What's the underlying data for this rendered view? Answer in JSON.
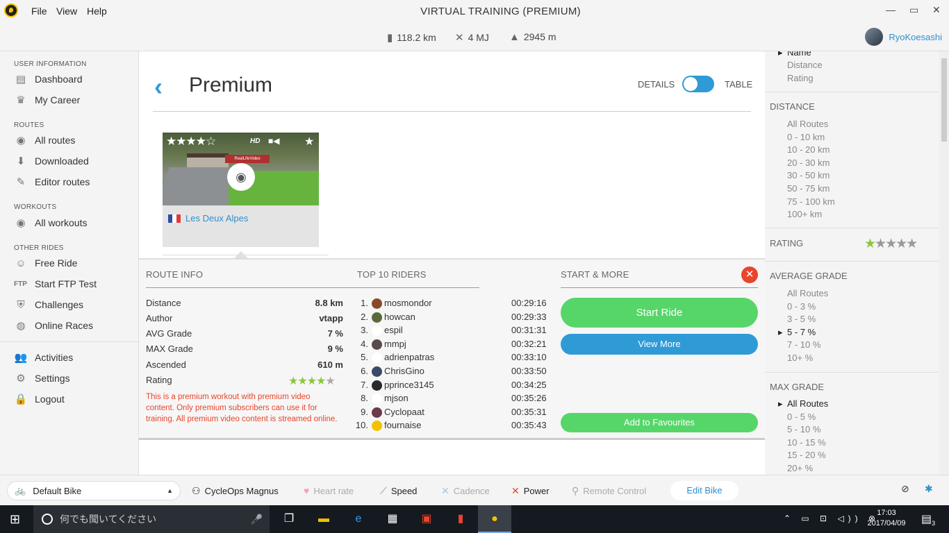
{
  "window": {
    "title": "VIRTUAL TRAINING (PREMIUM)",
    "minimize": "—",
    "restore": "▭",
    "close": "✕"
  },
  "menu": {
    "file": "File",
    "view": "View",
    "help": "Help"
  },
  "stats": {
    "distance": "118.2 km",
    "energy": "4 MJ",
    "climb": "2945 m"
  },
  "user": {
    "name": "RyoKoesashi"
  },
  "sidebar": {
    "user_info": "USER INFORMATION",
    "dashboard": "Dashboard",
    "career": "My Career",
    "routes": "ROUTES",
    "all_routes": "All routes",
    "downloaded": "Downloaded",
    "editor_routes": "Editor routes",
    "workouts": "WORKOUTS",
    "all_workouts": "All workouts",
    "other_rides": "OTHER RIDES",
    "free_ride": "Free Ride",
    "ftp_prefix": "FTP",
    "ftp_test": "Start FTP Test",
    "challenges": "Challenges",
    "online_races": "Online Races",
    "activities": "Activities",
    "settings": "Settings",
    "logout": "Logout"
  },
  "page": {
    "back": "‹",
    "title": "Premium",
    "details_label": "DETAILS",
    "table_label": "TABLE",
    "toggle_state": "table"
  },
  "card": {
    "rating_stars": "★★★★☆",
    "rating": 4,
    "hd": "HD",
    "camera": "■◀",
    "fav": "★",
    "sign": "RealLifeVideo",
    "name": "Les Deux Alpes",
    "country": "France"
  },
  "route_info": {
    "header": "ROUTE INFO",
    "rows": [
      {
        "label": "Distance",
        "value": "8.8 km"
      },
      {
        "label": "Author",
        "value": "vtapp"
      },
      {
        "label": "AVG Grade",
        "value": "7 %"
      },
      {
        "label": "MAX Grade",
        "value": "9 %"
      },
      {
        "label": "Ascended",
        "value": "610 m"
      },
      {
        "label": "Rating",
        "value": ""
      }
    ],
    "rating_filled": "★★★★",
    "rating_empty": "★",
    "rating": 4,
    "description": "This is a premium workout with premium video content. Only premium subscribers can use it for training. All premium video content is streamed online."
  },
  "top_riders": {
    "header": "TOP 10 RIDERS",
    "rows": [
      {
        "rank": "1.",
        "name": "mosmondor",
        "time": "00:29:16",
        "avatar_color": "#8a4a2a"
      },
      {
        "rank": "2.",
        "name": "howcan",
        "time": "00:29:33",
        "avatar_color": "#5a6a3a"
      },
      {
        "rank": "3.",
        "name": "espil",
        "time": "00:31:31",
        "avatar_color": "#ffffff"
      },
      {
        "rank": "4.",
        "name": "mmpj",
        "time": "00:32:21",
        "avatar_color": "#5a4a4a"
      },
      {
        "rank": "5.",
        "name": "adrienpatras",
        "time": "00:33:10",
        "avatar_color": "#ffffff"
      },
      {
        "rank": "6.",
        "name": "ChrisGino",
        "time": "00:33:50",
        "avatar_color": "#3a4a6a"
      },
      {
        "rank": "7.",
        "name": "pprince3145",
        "time": "00:34:25",
        "avatar_color": "#2a2a2a"
      },
      {
        "rank": "8.",
        "name": "mjson",
        "time": "00:35:26",
        "avatar_color": "#ffffff"
      },
      {
        "rank": "9.",
        "name": "Cyclopaat",
        "time": "00:35:31",
        "avatar_color": "#6a3a4a"
      },
      {
        "rank": "10.",
        "name": "fournaise",
        "time": "00:35:43",
        "avatar_color": "#f2c200"
      }
    ]
  },
  "start_more": {
    "header": "START & MORE",
    "close": "✕",
    "start": "Start Ride",
    "more": "View More",
    "favourites": "Add to Favourites"
  },
  "filters": {
    "sort_options": [
      "Name",
      "Distance",
      "Rating"
    ],
    "distance_header": "DISTANCE",
    "distance_options": [
      "All Routes",
      "0 - 10 km",
      "10 - 20 km",
      "20 - 30 km",
      "30 - 50 km",
      "50 - 75 km",
      "75 - 100 km",
      "100+ km"
    ],
    "rating_header": "RATING",
    "rating_filled": "★",
    "rating_empty": "★★★★",
    "rating_value": 1,
    "avg_grade_header": "AVERAGE GRADE",
    "avg_grade_options": [
      "All Routes",
      "0 - 3 %",
      "3 - 5 %",
      "5 - 7 %",
      "7 - 10 %",
      "10+ %"
    ],
    "avg_grade_selected": 3,
    "max_grade_header": "MAX GRADE",
    "max_grade_options": [
      "All Routes",
      "0 - 5 %",
      "5 - 10 %",
      "10 - 15 %",
      "15 - 20 %",
      "20+ %"
    ],
    "max_grade_selected": 0
  },
  "bottombar": {
    "bike": "Default Bike",
    "trainer": "CycleOps Magnus",
    "heart": "Heart rate",
    "speed": "Speed",
    "cadence": "Cadence",
    "power": "Power",
    "remote": "Remote Control",
    "edit_bike": "Edit Bike"
  },
  "taskbar": {
    "search_placeholder": "何でも聞いてください",
    "time": "17:03",
    "date": "2017/04/09",
    "notifications": "3"
  },
  "colors": {
    "accent": "#2e9bd6",
    "green": "#56d669",
    "red": "#e8452c",
    "star": "#8cc63f"
  }
}
